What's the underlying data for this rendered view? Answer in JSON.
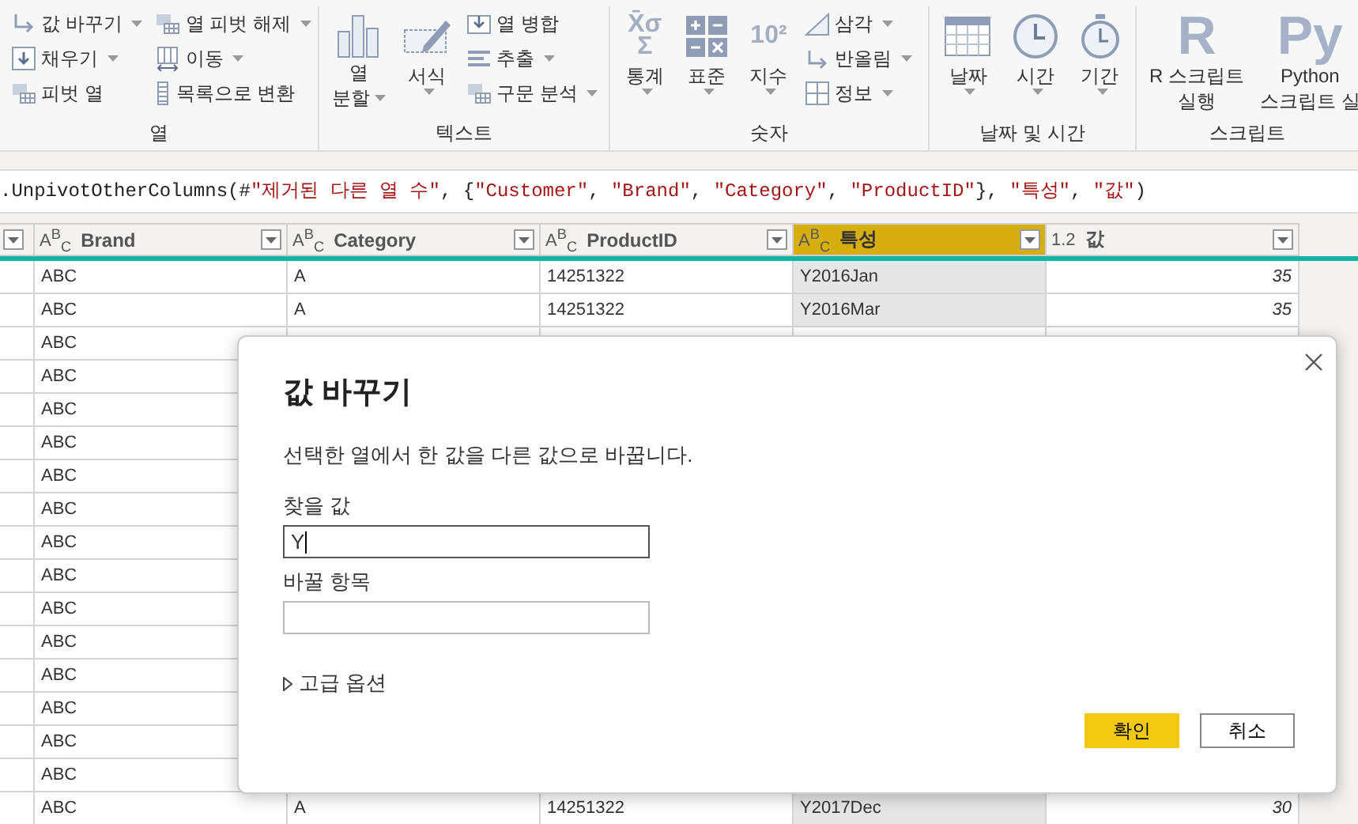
{
  "ribbon": {
    "groups": [
      {
        "label": "열",
        "items": [
          {
            "kind": "small",
            "label": "값 바꾸기",
            "dropdown": true
          },
          {
            "kind": "small",
            "label": "채우기",
            "dropdown": true
          },
          {
            "kind": "small",
            "label": "피벗 열",
            "dropdown": false
          },
          {
            "kind": "small",
            "label": "열 피벗 해제",
            "dropdown": true
          },
          {
            "kind": "small",
            "label": "이동",
            "dropdown": true
          },
          {
            "kind": "small",
            "label": "목록으로 변환",
            "dropdown": false
          }
        ]
      },
      {
        "label": "텍스트",
        "items": [
          {
            "kind": "large",
            "lines": [
              "열",
              "분할"
            ],
            "dropdown": true
          },
          {
            "kind": "large",
            "lines": [
              "서식"
            ],
            "dropdown": true
          },
          {
            "kind": "small",
            "label": "열 병합",
            "dropdown": false
          },
          {
            "kind": "small",
            "label": "추출",
            "dropdown": true
          },
          {
            "kind": "small",
            "label": "구문 분석",
            "dropdown": true
          }
        ]
      },
      {
        "label": "숫자",
        "items": [
          {
            "kind": "large",
            "lines": [
              "통계"
            ],
            "dropdown": true,
            "glyph": [
              "X̄σ",
              "Σ"
            ]
          },
          {
            "kind": "large",
            "lines": [
              "표준"
            ],
            "dropdown": true
          },
          {
            "kind": "large",
            "lines": [
              "지수"
            ],
            "dropdown": true,
            "glyph": [
              "10²"
            ]
          },
          {
            "kind": "small",
            "label": "삼각",
            "dropdown": true
          },
          {
            "kind": "small",
            "label": "반올림",
            "dropdown": true
          },
          {
            "kind": "small",
            "label": "정보",
            "dropdown": true
          }
        ]
      },
      {
        "label": "날짜 및 시간",
        "items": [
          {
            "kind": "large",
            "lines": [
              "날짜"
            ],
            "dropdown": true
          },
          {
            "kind": "large",
            "lines": [
              "시간"
            ],
            "dropdown": true
          },
          {
            "kind": "large",
            "lines": [
              "기간"
            ],
            "dropdown": true
          }
        ]
      },
      {
        "label": "스크립트",
        "items": [
          {
            "kind": "large",
            "lines": [
              "R 스크립트",
              "실행"
            ],
            "dropdown": false,
            "glyph": [
              "R"
            ]
          },
          {
            "kind": "large",
            "lines": [
              "Python",
              "스크립트 실"
            ],
            "dropdown": false,
            "glyph": [
              "Py"
            ]
          }
        ]
      }
    ]
  },
  "formula": {
    "parts": [
      {
        "kind": "code",
        "text": ".UnpivotOtherColumns(#"
      },
      {
        "kind": "string",
        "text": "\"제거된 다른 열 수\""
      },
      {
        "kind": "code",
        "text": ", {"
      },
      {
        "kind": "string",
        "text": "\"Customer\""
      },
      {
        "kind": "code",
        "text": ", "
      },
      {
        "kind": "string",
        "text": "\"Brand\""
      },
      {
        "kind": "code",
        "text": ", "
      },
      {
        "kind": "string",
        "text": "\"Category\""
      },
      {
        "kind": "code",
        "text": ", "
      },
      {
        "kind": "string",
        "text": "\"ProductID\""
      },
      {
        "kind": "code",
        "text": "}, "
      },
      {
        "kind": "string",
        "text": "\"특성\""
      },
      {
        "kind": "code",
        "text": ", "
      },
      {
        "kind": "string",
        "text": "\"값\""
      },
      {
        "kind": "code",
        "text": ")"
      }
    ]
  },
  "table": {
    "columns": [
      {
        "name": "Brand",
        "type_label": "A$^{B}$$_{C}$",
        "kind": "text",
        "selected": false
      },
      {
        "name": "Category",
        "type_label": "A$^{B}$$_{C}$",
        "kind": "text",
        "selected": false
      },
      {
        "name": "ProductID",
        "type_label": "A$^{B}$$_{C}$",
        "kind": "text",
        "selected": false
      },
      {
        "name": "특성",
        "type_label": "A$^{B}$$_{C}$",
        "kind": "text",
        "selected": true
      },
      {
        "name": "값",
        "type_label": "1.2",
        "kind": "number",
        "selected": false
      }
    ],
    "rows": [
      {
        "cells": [
          "ABC",
          "A",
          "14251322",
          "Y2016Jan",
          "35"
        ]
      },
      {
        "cells": [
          "ABC",
          "A",
          "14251322",
          "Y2016Mar",
          "35"
        ]
      },
      {
        "cells": [
          "ABC"
        ]
      },
      {
        "cells": [
          "ABC"
        ]
      },
      {
        "cells": [
          "ABC"
        ]
      },
      {
        "cells": [
          "ABC"
        ]
      },
      {
        "cells": [
          "ABC"
        ]
      },
      {
        "cells": [
          "ABC"
        ]
      },
      {
        "cells": [
          "ABC"
        ]
      },
      {
        "cells": [
          "ABC"
        ]
      },
      {
        "cells": [
          "ABC"
        ]
      },
      {
        "cells": [
          "ABC"
        ]
      },
      {
        "cells": [
          "ABC"
        ]
      },
      {
        "cells": [
          "ABC"
        ]
      },
      {
        "cells": [
          "ABC"
        ]
      },
      {
        "cells": [
          "ABC"
        ]
      },
      {
        "cells": [
          "ABC",
          "A",
          "14251322",
          "Y2017Dec",
          "30"
        ]
      }
    ]
  },
  "dialog": {
    "title": "값 바꾸기",
    "description": "선택한 열에서 한 값을 다른 값으로 바꿉니다.",
    "fields": [
      {
        "label": "찾을 값",
        "value": "Y",
        "focused": true
      },
      {
        "label": "바꿀 항목",
        "focused": false
      }
    ],
    "advanced": {
      "label": "고급 옵션",
      "expanded": false
    },
    "buttons": [
      {
        "label": "확인",
        "primary": true
      },
      {
        "label": "취소",
        "primary": false
      }
    ]
  }
}
